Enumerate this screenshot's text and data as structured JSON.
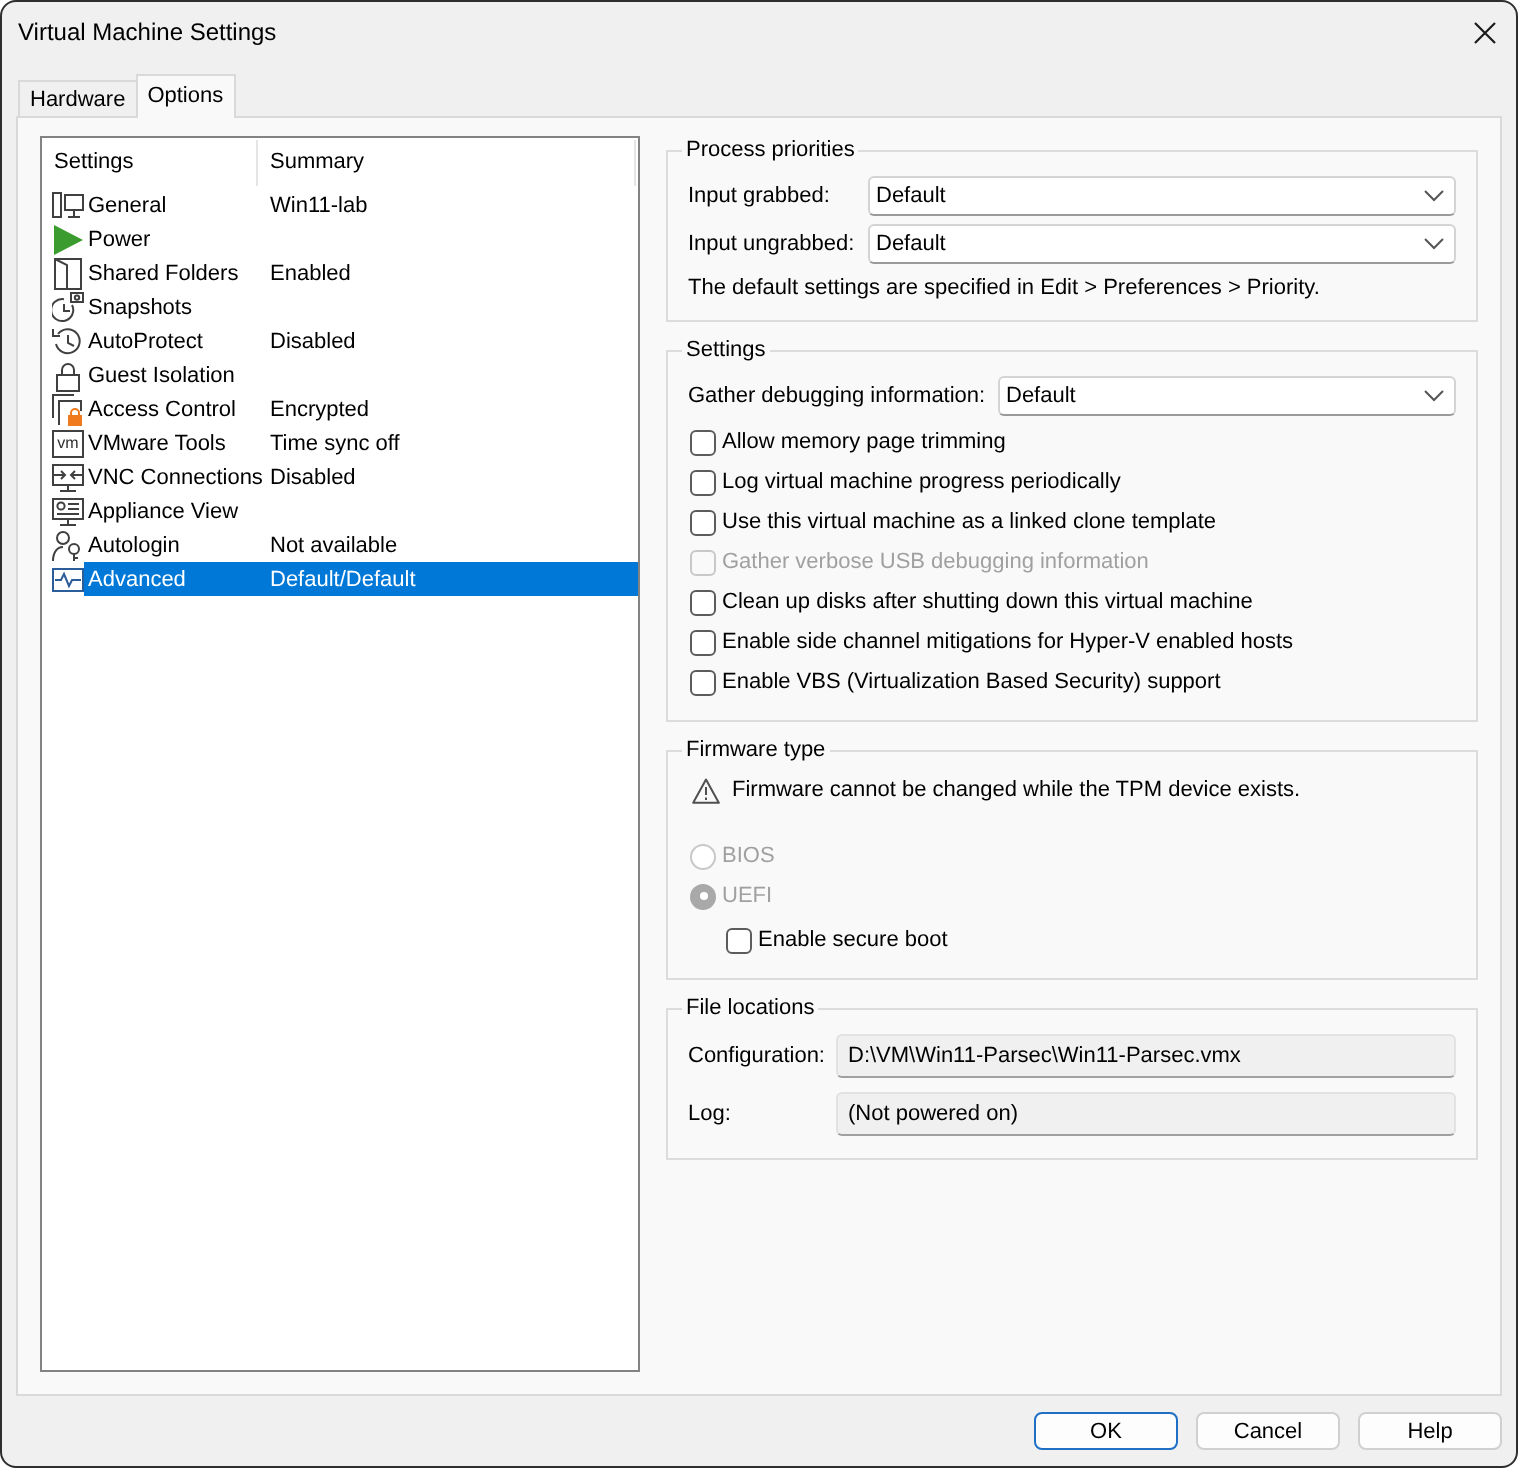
{
  "window": {
    "title": "Virtual Machine Settings"
  },
  "tabs": [
    {
      "label": "Hardware",
      "selected": false
    },
    {
      "label": "Options",
      "selected": true
    }
  ],
  "settings_list": {
    "columns": [
      "Settings",
      "Summary"
    ],
    "rows": [
      {
        "name": "General",
        "summary": "Win11-lab",
        "selected": false
      },
      {
        "name": "Power",
        "selected": false
      },
      {
        "name": "Shared Folders",
        "summary": "Enabled",
        "selected": false
      },
      {
        "name": "Snapshots",
        "selected": false
      },
      {
        "name": "AutoProtect",
        "summary": "Disabled",
        "selected": false
      },
      {
        "name": "Guest Isolation",
        "selected": false
      },
      {
        "name": "Access Control",
        "summary": "Encrypted",
        "selected": false
      },
      {
        "name": "VMware Tools",
        "summary": "Time sync off",
        "selected": false,
        "icon_label": "vm"
      },
      {
        "name": "VNC Connections",
        "summary": "Disabled",
        "selected": false
      },
      {
        "name": "Appliance View",
        "selected": false
      },
      {
        "name": "Autologin",
        "summary": "Not available",
        "selected": false
      },
      {
        "name": "Advanced",
        "summary": "Default/Default",
        "selected": true
      }
    ]
  },
  "process_priorities": {
    "title": "Process priorities",
    "fields": [
      {
        "label": "Input grabbed:",
        "value": "Default"
      },
      {
        "label": "Input ungrabbed:",
        "value": "Default"
      }
    ],
    "note": "The default settings are specified in Edit > Preferences > Priority."
  },
  "settings": {
    "title": "Settings",
    "debug": {
      "label": "Gather debugging information:",
      "value": "Default"
    },
    "options": [
      {
        "label": "Allow memory page trimming",
        "checked": false,
        "disabled": false
      },
      {
        "label": "Log virtual machine progress periodically",
        "checked": false,
        "disabled": false
      },
      {
        "label": "Use this virtual machine as a linked clone template",
        "checked": false,
        "disabled": false
      },
      {
        "label": "Gather verbose USB debugging information",
        "checked": false,
        "disabled": true
      },
      {
        "label": "Clean up disks after shutting down this virtual machine",
        "checked": false,
        "disabled": false
      },
      {
        "label": "Enable side channel mitigations for Hyper-V enabled hosts",
        "checked": false,
        "disabled": false
      },
      {
        "label": "Enable VBS (Virtualization Based Security) support",
        "checked": false,
        "disabled": false
      }
    ]
  },
  "firmware": {
    "title": "Firmware type",
    "warning": "Firmware cannot be changed while the TPM device exists.",
    "types": [
      {
        "label": "BIOS",
        "selected": false,
        "disabled": true
      },
      {
        "label": "UEFI",
        "selected": true,
        "disabled": true
      }
    ],
    "secure_boot": {
      "label": "Enable secure boot",
      "checked": false
    }
  },
  "file_locations": {
    "title": "File locations",
    "fields": [
      {
        "label": "Configuration:",
        "value": "D:\\VM\\Win11-Parsec\\Win11-Parsec.vmx"
      },
      {
        "label": "Log:",
        "value": "(Not powered on)"
      }
    ]
  },
  "buttons": [
    {
      "label": "OK",
      "default": true
    },
    {
      "label": "Cancel",
      "default": false
    },
    {
      "label": "Help",
      "default": false
    }
  ]
}
